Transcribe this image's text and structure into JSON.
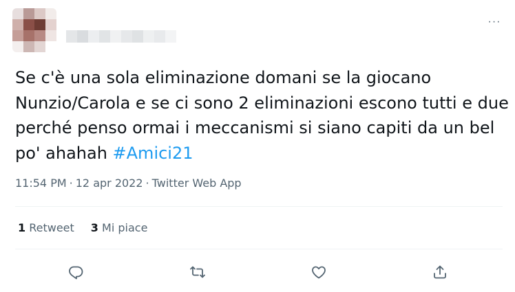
{
  "tweet": {
    "text_parts": [
      "Se c'è una sola eliminazione domani se la giocano Nunzio/Carola e se ci sono 2 eliminazioni escono tutti e due perché penso ormai i meccanismi si siano capiti da un bel po' ahahah ",
      "#Amici21"
    ],
    "time": "11:54 PM",
    "separator": "·",
    "date": "12 apr 2022",
    "source": "Twitter Web App"
  },
  "more_icon": "···",
  "stats": {
    "retweets_count": "1",
    "retweets_label": "Retweet",
    "likes_count": "3",
    "likes_label": "Mi piace"
  },
  "actions": [
    "reply-icon",
    "retweet-icon",
    "like-icon",
    "share-icon"
  ],
  "colors": {
    "hashtag": "#1d9bf0",
    "muted": "#536471",
    "text": "#0f1419",
    "divider": "#eff3f4"
  }
}
